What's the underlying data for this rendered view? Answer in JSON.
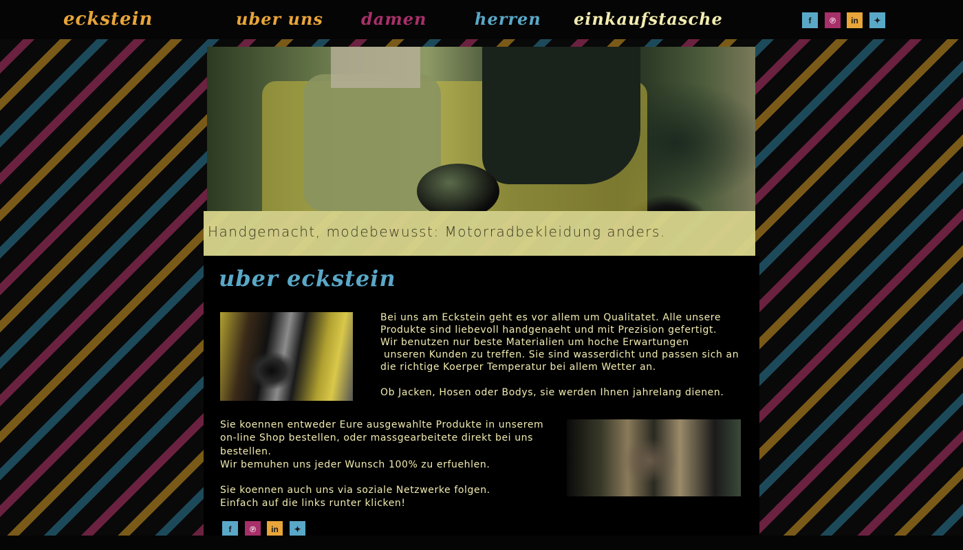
{
  "nav": {
    "logo": "eckstein",
    "items": [
      {
        "label": "uber uns",
        "color": "#e8a53a"
      },
      {
        "label": "damen",
        "color": "#a8306a"
      },
      {
        "label": "herren",
        "color": "#5aa8c8"
      },
      {
        "label": "einkaufstasche",
        "color": "#f2ecb0"
      }
    ]
  },
  "social": [
    {
      "icon": "facebook-icon",
      "glyph": "f"
    },
    {
      "icon": "pinterest-icon",
      "glyph": "℗"
    },
    {
      "icon": "linkedin-icon",
      "glyph": "in"
    },
    {
      "icon": "twitter-icon",
      "glyph": "✦"
    }
  ],
  "hero": {
    "caption": "Handgemacht, modebewusst: Motorradbekleidung anders."
  },
  "about": {
    "heading": "uber eckstein",
    "para1": [
      "Bei uns am Eckstein geht es vor allem um Qualitatet. Alle unsere",
      "Produkte sind liebevoll handgenaeht und mit Prezision gefertigt.",
      "Wir benutzen nur beste Materialien um hoche Erwartungen",
      " unseren Kunden zu treffen. Sie sind wasserdicht und passen sich an",
      "die richtige Koerper Temperatur bei allem Wetter an."
    ],
    "para2": "Ob Jacken, Hosen oder Bodys, sie werden Ihnen jahrelang dienen.",
    "para3": [
      "Sie koennen entweder Eure ausgewahlte Produkte in unserem",
      "on-line Shop bestellen, oder massgearbeitete direkt bei uns",
      "bestellen.",
      "Wir bemuhen uns jeder Wunsch 100% zu erfuehlen."
    ],
    "para4": [
      "Sie koennen auch uns via soziale Netzwerke folgen.",
      "Einfach auf die links runter klicken!"
    ]
  },
  "colors": {
    "accent_orange": "#e8a53a",
    "accent_magenta": "#a8306a",
    "accent_blue": "#5aa8c8",
    "text_cream": "#f2ecb0"
  }
}
